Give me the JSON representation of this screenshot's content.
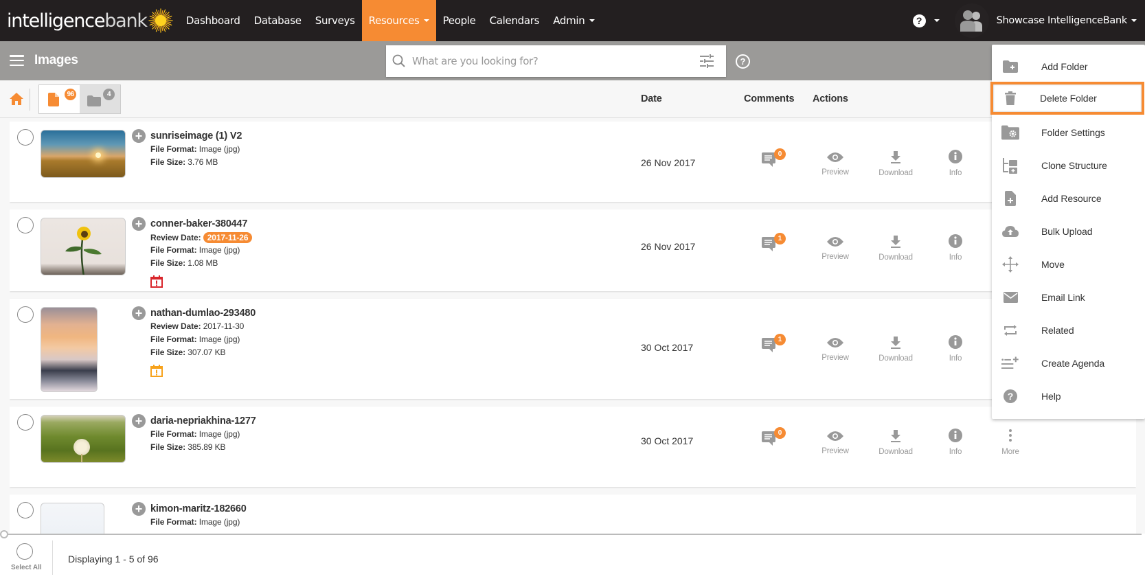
{
  "app": {
    "logo_text_main": "intelligence",
    "logo_text_accent": "bank",
    "brand_color": "#f68b33"
  },
  "nav": {
    "items": [
      {
        "label": "Dashboard",
        "active": false,
        "dropdown": false
      },
      {
        "label": "Database",
        "active": false,
        "dropdown": false
      },
      {
        "label": "Surveys",
        "active": false,
        "dropdown": false
      },
      {
        "label": "Resources",
        "active": true,
        "dropdown": true
      },
      {
        "label": "People",
        "active": false,
        "dropdown": false
      },
      {
        "label": "Calendars",
        "active": false,
        "dropdown": false
      },
      {
        "label": "Admin",
        "active": false,
        "dropdown": true
      }
    ],
    "help_icon": "question-circle-icon",
    "user_name": "Showcase IntelligenceBank"
  },
  "subheader": {
    "title": "Images",
    "search_placeholder": "What are you looking for?",
    "search_value": ""
  },
  "toolbar": {
    "files_count": "96",
    "folders_count": "4",
    "columns": {
      "date": "Date",
      "comments": "Comments",
      "actions": "Actions"
    }
  },
  "labels": {
    "review_date": "Review Date:",
    "file_format": "File Format:",
    "file_size": "File Size:",
    "preview": "Preview",
    "download": "Download",
    "info": "Info",
    "more": "More"
  },
  "resources": [
    {
      "title": "sunriseimage (1) V2",
      "review_date": null,
      "file_format": "Image (jpg)",
      "file_size": "3.76 MB",
      "date": "26 Nov 2017",
      "comments": "0",
      "review_status": null
    },
    {
      "title": "conner-baker-380447",
      "review_date": "2017-11-26",
      "review_date_highlight": true,
      "file_format": "Image (jpg)",
      "file_size": "1.08 MB",
      "date": "26 Nov 2017",
      "comments": "1",
      "review_status": "overdue"
    },
    {
      "title": "nathan-dumlao-293480",
      "review_date": "2017-11-30",
      "review_date_highlight": false,
      "file_format": "Image (jpg)",
      "file_size": "307.07 KB",
      "date": "30 Oct 2017",
      "comments": "1",
      "review_status": "upcoming"
    },
    {
      "title": "daria-nepriakhina-1277",
      "review_date": null,
      "file_format": "Image (jpg)",
      "file_size": "385.89 KB",
      "date": "30 Oct 2017",
      "comments": "0",
      "review_status": null
    },
    {
      "title": "kimon-maritz-182660",
      "review_date": null,
      "file_format": "Image (jpg)",
      "file_size": null,
      "date": null,
      "comments": null,
      "review_status": null
    }
  ],
  "footer": {
    "select_all": "Select All",
    "displaying": "Displaying 1 - 5 of 96"
  },
  "menu": {
    "items": [
      {
        "label": "Add Folder",
        "icon": "folder-plus-icon"
      },
      {
        "label": "Delete Folder",
        "icon": "trash-icon",
        "highlighted": true
      },
      {
        "label": "Folder Settings",
        "icon": "folder-gear-icon"
      },
      {
        "label": "Clone Structure",
        "icon": "clone-structure-icon"
      },
      {
        "label": "Add Resource",
        "icon": "file-plus-icon"
      },
      {
        "label": "Bulk Upload",
        "icon": "cloud-upload-icon"
      },
      {
        "label": "Move",
        "icon": "move-arrows-icon"
      },
      {
        "label": "Email Link",
        "icon": "envelope-icon"
      },
      {
        "label": "Related",
        "icon": "repeat-arrows-icon"
      },
      {
        "label": "Create Agenda",
        "icon": "list-plus-icon"
      },
      {
        "label": "Help",
        "icon": "question-circle-icon"
      }
    ]
  }
}
